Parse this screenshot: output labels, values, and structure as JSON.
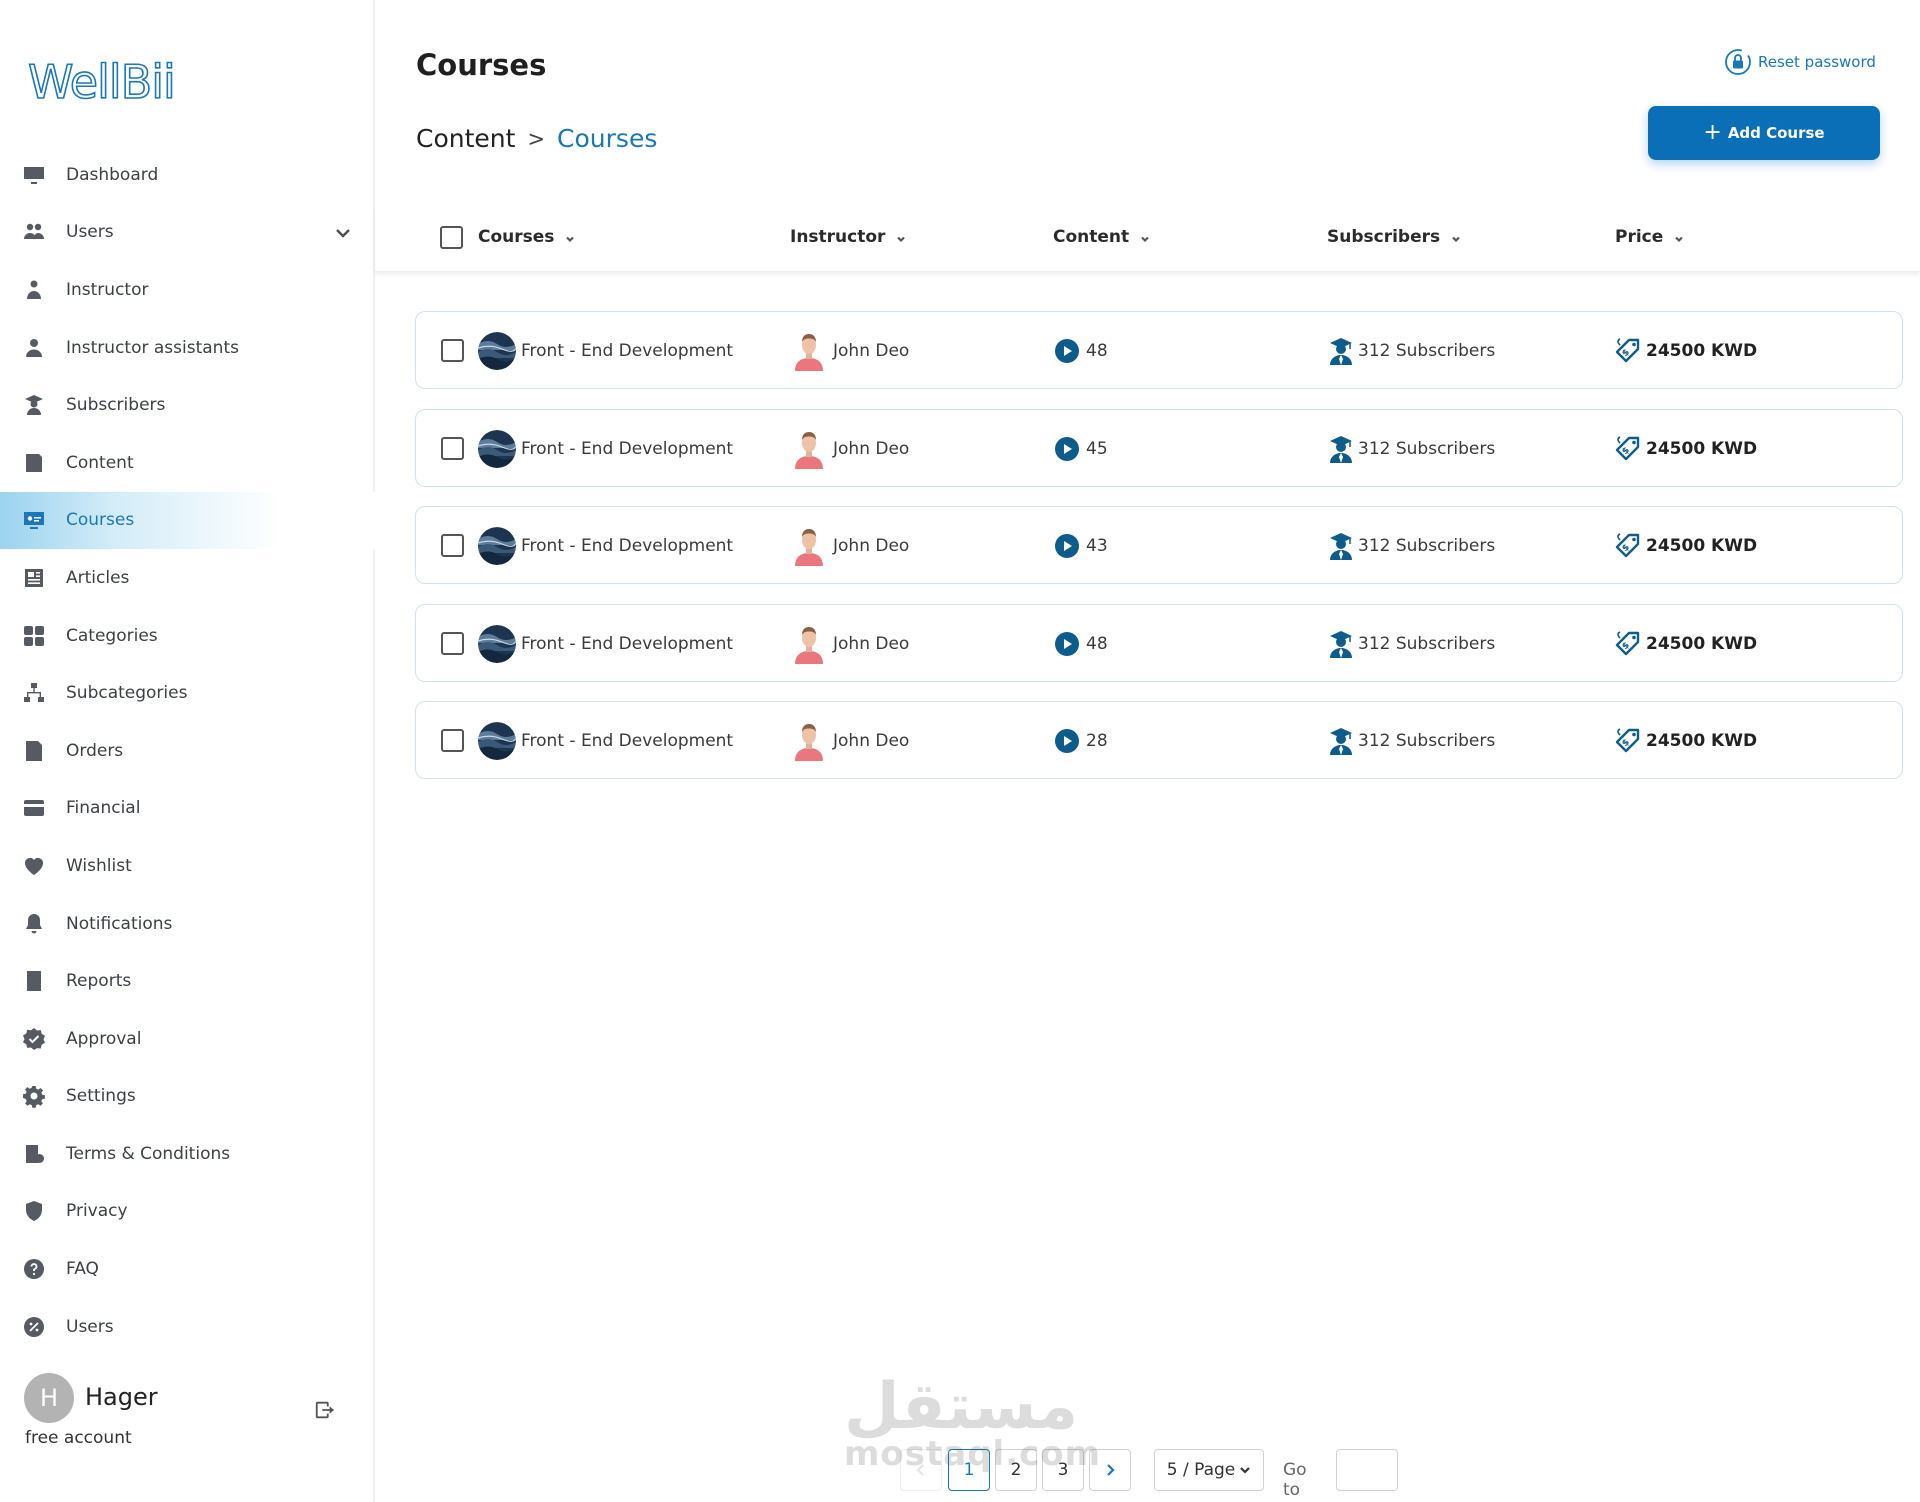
{
  "brand": {
    "logo_text": "WellBii",
    "accent": "#1a77b8"
  },
  "sidebar": {
    "items": [
      {
        "key": "dashboard",
        "label": "Dashboard",
        "icon": "monitor-icon"
      },
      {
        "key": "users",
        "label": "Users",
        "icon": "users-icon",
        "expandable": true
      },
      {
        "key": "instructor",
        "label": "Instructor",
        "icon": "instructor-icon"
      },
      {
        "key": "instructor-assistants",
        "label": "Instructor assistants",
        "icon": "assistant-icon"
      },
      {
        "key": "subscribers",
        "label": "Subscribers",
        "icon": "graduate-icon"
      },
      {
        "key": "content",
        "label": "Content",
        "icon": "content-icon"
      },
      {
        "key": "courses",
        "label": "Courses",
        "icon": "course-icon",
        "active": true
      },
      {
        "key": "articles",
        "label": "Articles",
        "icon": "article-icon"
      },
      {
        "key": "categories",
        "label": "Categories",
        "icon": "grid-icon"
      },
      {
        "key": "subcategories",
        "label": "Subcategories",
        "icon": "hierarchy-icon"
      },
      {
        "key": "orders",
        "label": "Orders",
        "icon": "orders-icon"
      },
      {
        "key": "financial",
        "label": "Financial",
        "icon": "card-icon"
      },
      {
        "key": "wishlist",
        "label": "Wishlist",
        "icon": "heart-icon"
      },
      {
        "key": "notifications",
        "label": "Notifications",
        "icon": "bell-icon"
      },
      {
        "key": "reports",
        "label": "Reports",
        "icon": "report-icon"
      },
      {
        "key": "approval",
        "label": "Approval",
        "icon": "approval-icon"
      },
      {
        "key": "settings",
        "label": "Settings",
        "icon": "gear-icon"
      },
      {
        "key": "terms",
        "label": "Terms & Conditions",
        "icon": "terms-icon"
      },
      {
        "key": "privacy",
        "label": "Privacy",
        "icon": "shield-icon"
      },
      {
        "key": "faq",
        "label": "FAQ",
        "icon": "question-icon"
      },
      {
        "key": "users-2",
        "label": "Users",
        "icon": "percent-icon"
      }
    ],
    "user": {
      "initial": "H",
      "name": "Hager",
      "plan": "free account"
    }
  },
  "header": {
    "title": "Courses",
    "reset_label": "Reset password",
    "breadcrumb": [
      "Content",
      "Courses"
    ],
    "breadcrumb_sep": ">",
    "add_button": "Add Course"
  },
  "table": {
    "columns": [
      "Courses",
      "Instructor",
      "Content",
      "Subscribers",
      "Price"
    ],
    "rows": [
      {
        "course": "Front - End Development",
        "instructor": "John Deo",
        "content": "48",
        "subscribers": "312 Subscribers",
        "price": "24500 KWD"
      },
      {
        "course": "Front - End Development",
        "instructor": "John Deo",
        "content": "45",
        "subscribers": "312 Subscribers",
        "price": "24500 KWD"
      },
      {
        "course": "Front - End Development",
        "instructor": "John Deo",
        "content": "43",
        "subscribers": "312 Subscribers",
        "price": "24500 KWD"
      },
      {
        "course": "Front - End Development",
        "instructor": "John Deo",
        "content": "48",
        "subscribers": "312 Subscribers",
        "price": "24500 KWD"
      },
      {
        "course": "Front - End Development",
        "instructor": "John Deo",
        "content": "28",
        "subscribers": "312 Subscribers",
        "price": "24500 KWD"
      }
    ]
  },
  "pagination": {
    "pages": [
      "1",
      "2",
      "3"
    ],
    "current": "1",
    "per_page": "5 / Page",
    "goto_label": "Go to",
    "goto_value": ""
  },
  "watermark": {
    "arabic": "مستقل",
    "latin": "mostaql.com"
  }
}
